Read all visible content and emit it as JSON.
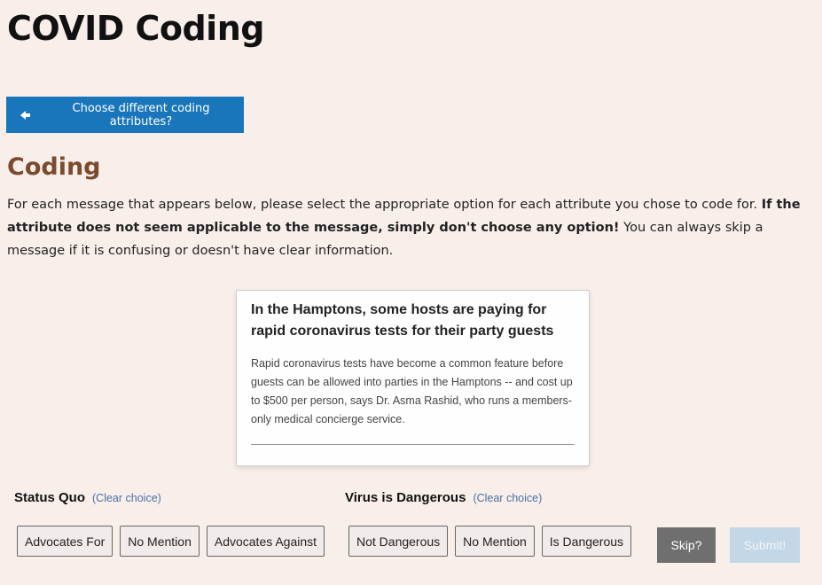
{
  "header": {
    "title": "COVID Coding"
  },
  "back_button": {
    "label": "Choose different coding attributes?",
    "icon": "arrow-left-icon"
  },
  "coding": {
    "heading": "Coding",
    "instructions_part1": "For each message that appears below, please select the appropriate option for each attribute you chose to code for. ",
    "instructions_bold": "If the attribute does not seem applicable to the message, simply don't choose any option!",
    "instructions_part2": " You can always skip a message if it is confusing or doesn't have clear information."
  },
  "message": {
    "title": "In the Hamptons, some hosts are paying for rapid coronavirus tests for their party guests",
    "body": "Rapid coronavirus tests have become a common feature before guests can be allowed into parties in the Hamptons -- and cost up to $500 per person, says Dr. Asma Rashid, who runs a members-only medical concierge service."
  },
  "attributes": [
    {
      "label": "Status Quo",
      "clear_label": "(Clear choice)",
      "options": [
        "Advocates For",
        "No Mention",
        "Advocates Against"
      ]
    },
    {
      "label": "Virus is Dangerous",
      "clear_label": "(Clear choice)",
      "options": [
        "Not Dangerous",
        "No Mention",
        "Is Dangerous"
      ]
    }
  ],
  "actions": {
    "skip_label": "Skip?",
    "submit_label": "Submit!"
  },
  "colors": {
    "background": "#f8efea",
    "primary_button": "#1a76bb",
    "heading_brown": "#7c4a2d",
    "skip_gray": "#6f6f6f",
    "submit_disabled": "#c4d7e6",
    "link_blue": "#4a6fa5"
  }
}
